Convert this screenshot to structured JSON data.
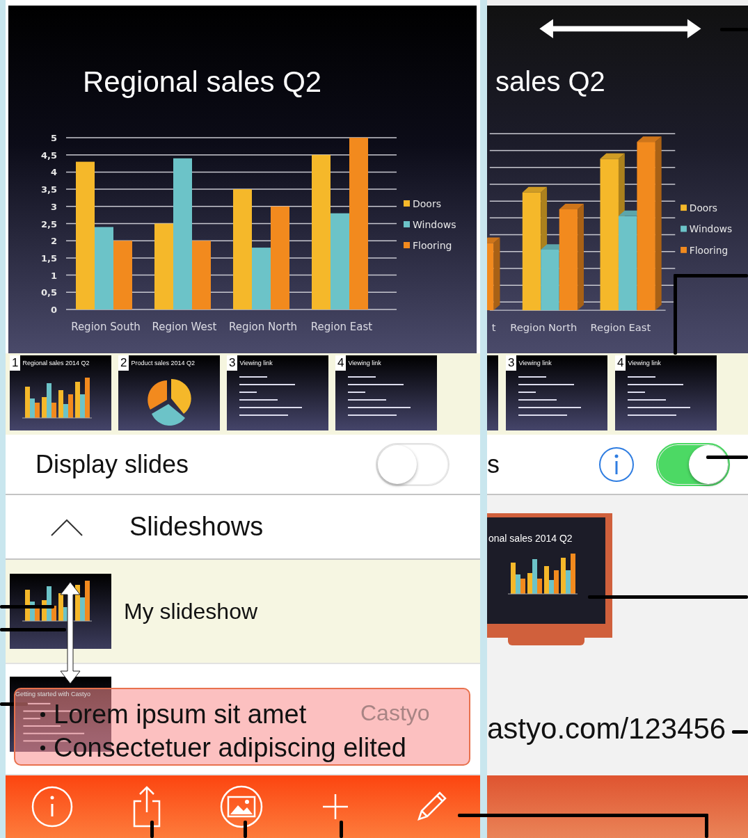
{
  "left_screen": {
    "slide": {
      "title": "Regional sales Q2",
      "chart_data": {
        "type": "bar",
        "categories": [
          "Region South",
          "Region West",
          "Region North",
          "Region East"
        ],
        "series": [
          {
            "name": "Doors",
            "color": "#f5b82a",
            "values": [
              4.3,
              2.5,
              3.5,
              4.5
            ]
          },
          {
            "name": "Windows",
            "color": "#6cc3c8",
            "values": [
              2.4,
              4.4,
              1.8,
              2.8
            ]
          },
          {
            "name": "Flooring",
            "color": "#f28a1e",
            "values": [
              2.0,
              2.0,
              3.0,
              5.0
            ]
          }
        ],
        "ylim": [
          0,
          5
        ],
        "grid": true,
        "legend": true,
        "yticks": [
          0,
          {
            "value": 0.5,
            "label": "0,5"
          },
          1,
          {
            "value": 1.5,
            "label": "1,5"
          },
          2,
          {
            "value": 2.5,
            "label": "2,5"
          },
          3,
          {
            "value": 3.5,
            "label": "3,5"
          },
          4,
          {
            "value": 4.5,
            "label": "4,5"
          },
          5
        ]
      }
    },
    "thumbnails": [
      {
        "number": "1",
        "title": "Regional sales 2014 Q2",
        "kind": "chart"
      },
      {
        "number": "2",
        "title": "Product sales 2014 Q2",
        "kind": "pie"
      },
      {
        "number": "3",
        "title": "Viewing link",
        "kind": "text"
      },
      {
        "number": "4",
        "title": "Viewing link",
        "kind": "text"
      }
    ],
    "display_row": {
      "label": "Display slides",
      "on": false
    },
    "section": {
      "label": "Slideshows",
      "expanded": true
    },
    "slideshows": [
      {
        "title": "My slideshow",
        "kind": "chart",
        "selected": true
      },
      {
        "title": "Castyo",
        "thumb_title": "Getting started with Castyo",
        "kind": "text",
        "selected": false
      }
    ],
    "callout": {
      "bullets": [
        "Lorem ipsum sit amet",
        "Consectetuer adipiscing elited"
      ]
    },
    "toolbar": [
      {
        "kind": "info"
      },
      {
        "kind": "share"
      },
      {
        "kind": "image"
      },
      {
        "kind": "add"
      },
      {
        "kind": "edit"
      }
    ]
  },
  "right_screen": {
    "slide": {
      "title": "sales Q2",
      "legend": [
        "Doors",
        "Windows",
        "Flooring"
      ],
      "categories": [
        "t",
        "Region North",
        "Region East"
      ]
    },
    "thumbnails": [
      {
        "number": "3",
        "title": "Viewing link",
        "kind": "text"
      },
      {
        "number": "4",
        "title": "Viewing link",
        "kind": "text"
      }
    ],
    "display_row": {
      "label": "s",
      "on": true
    },
    "preview": {
      "title": "onal sales 2014 Q2"
    },
    "link": "astyo.com/123456"
  }
}
